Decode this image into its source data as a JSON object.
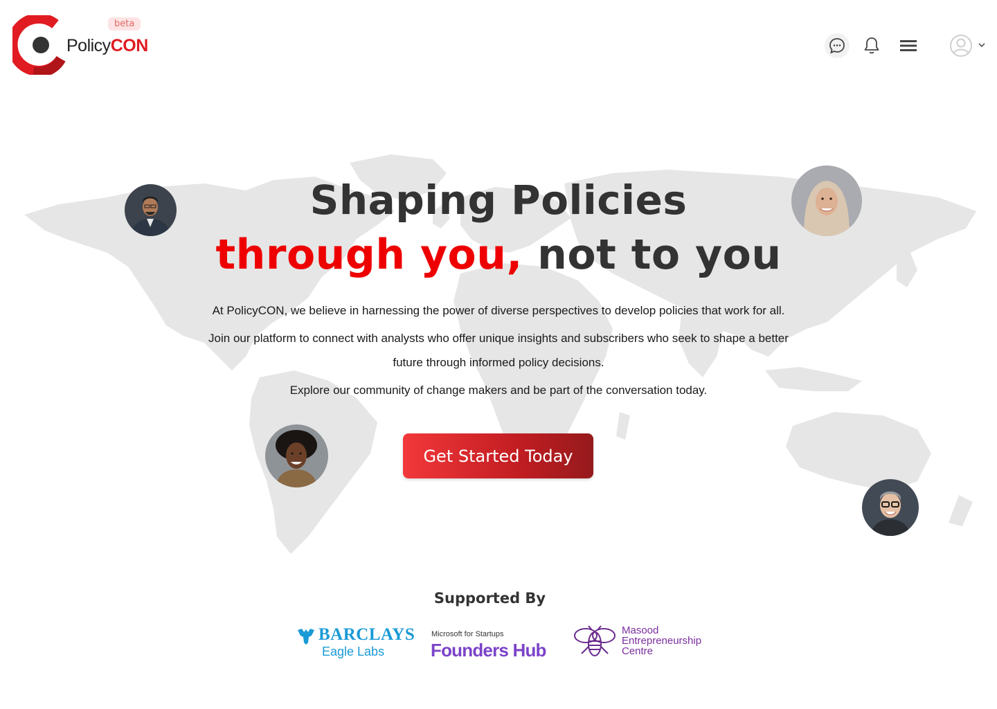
{
  "header": {
    "logo_text_1": "Policy",
    "logo_text_2": "CON",
    "beta_label": "beta",
    "icons": [
      "chat-icon",
      "bell-icon",
      "menu-icon",
      "user-avatar-icon",
      "chevron-down-icon"
    ]
  },
  "hero": {
    "title_line1": "Shaping Policies",
    "title_line2_highlight": "through you,",
    "title_line2_rest": " not to you",
    "paragraph1": "At PolicyCON, we believe in harnessing the power of diverse perspectives to develop policies that work for all.",
    "paragraph2_line1": "Join our platform to connect with analysts who offer unique insights and subscribers who seek to shape a better",
    "paragraph2_line2": "future through informed policy decisions.",
    "paragraph3": "Explore our community of change makers and be part of the conversation today.",
    "cta_label": "Get Started Today"
  },
  "supporters": {
    "heading": "Supported By",
    "barclays_name": "BARCLAYS",
    "barclays_sub": "Eagle Labs",
    "founders_small": "Microsoft for Startups",
    "founders_big": "Founders Hub",
    "masood_1": "Masood",
    "masood_2": "Entrepreneurship",
    "masood_3": "Centre"
  },
  "colors": {
    "brand_red": "#e11b22",
    "highlight_red": "#ee0000",
    "barclays_blue": "#1a9ad6",
    "founders_purple": "#7b43c9",
    "masood_purple": "#7a2e9e"
  }
}
